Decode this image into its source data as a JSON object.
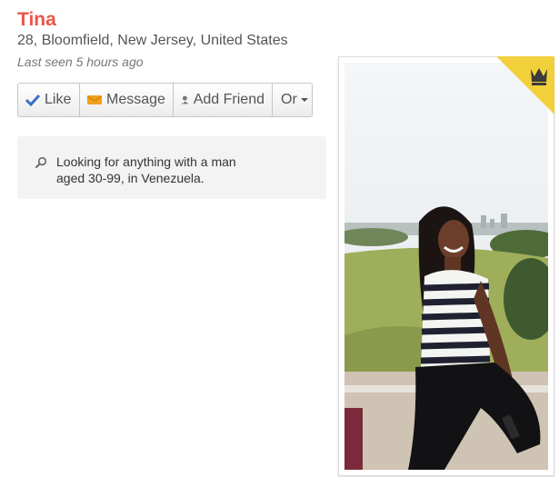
{
  "profile": {
    "name": "Tina",
    "location": "28, Bloomfield, New Jersey, United States",
    "last_seen": "Last seen 5 hours ago"
  },
  "actions": {
    "like": "Like",
    "message": "Message",
    "add_friend": "Add Friend",
    "more": "Or"
  },
  "looking_for": {
    "text": "Looking for anything with a man aged 30-99, in Venezuela."
  },
  "photo": {
    "badge_icon": "crown-icon",
    "badge_color": "#f2d03b"
  },
  "colors": {
    "name": "#e8564a",
    "like_check": "#3a6fc7",
    "message_icon": "#f0a21c"
  }
}
